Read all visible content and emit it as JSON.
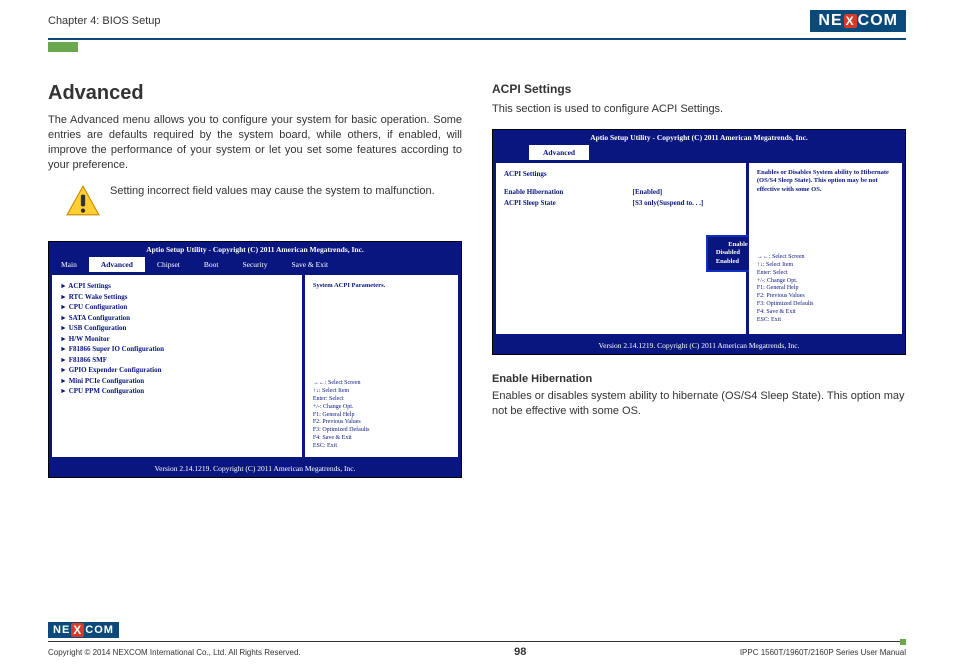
{
  "header": {
    "chapter": "Chapter 4: BIOS Setup",
    "logo_text_1": "NE",
    "logo_text_x": "X",
    "logo_text_2": "COM"
  },
  "left": {
    "title": "Advanced",
    "intro": "The Advanced menu allows you to configure your system for basic operation. Some entries are defaults required by the system board, while others, if enabled, will improve the performance of your system or let you set some features according to your preference.",
    "warning": "Setting incorrect field values may cause the system to malfunction.",
    "bios": {
      "title": "Aptio Setup Utility - Copyright (C) 2011 American Megatrends, Inc.",
      "tabs": [
        "Main",
        "Advanced",
        "Chipset",
        "Boot",
        "Security",
        "Save & Exit"
      ],
      "active_tab": 1,
      "items": [
        "ACPI Settings",
        "RTC Wake Settings",
        "CPU Configuration",
        "SATA Configuration",
        "USB Configuration",
        "H/W Monitor",
        "F81866 Super IO Configuration",
        "F81866 SMF",
        "GPIO Expender Configuration",
        "Mini PCIe Configuration",
        "CPU PPM Configuration"
      ],
      "right_top": "System ACPI Parameters.",
      "help": [
        "→←: Select Screen",
        "↑↓: Select Item",
        "Enter: Select",
        "+/-: Change Opt.",
        "F1: General Help",
        "F2: Previous Values",
        "F3: Optimized Defaults",
        "F4: Save & Exit",
        "ESC: Exit"
      ],
      "footer": "Version 2.14.1219. Copyright (C) 2011 American Megatrends, Inc."
    }
  },
  "right": {
    "title": "ACPI Settings",
    "intro": "This section is used to configure ACPI Settings.",
    "bios": {
      "title": "Aptio Setup Utility - Copyright (C) 2011 American Megatrends, Inc.",
      "tab_label": "Advanced",
      "section": "ACPI Settings",
      "row1_label": "Enable Hibernation",
      "row1_val": "[Enabled]",
      "row2_label": "ACPI Sleep State",
      "row2_val": "[S3 only(Suspend to. . .]",
      "right_top": "Enables or Disables System ability to Hibernate (OS/S4 Sleep State). This option may be not effective with some OS.",
      "popup_title": "Enable Hibernation",
      "popup_opt1": "Disabled",
      "popup_opt2": "Enabled",
      "help": [
        "→←: Select Screen",
        "↑↓: Select Item",
        "Enter: Select",
        "+/-: Change Opt.",
        "F1: General Help",
        "F2: Previous Values",
        "F3: Optimized Defaults",
        "F4: Save & Exit",
        "ESC: Exit"
      ],
      "footer": "Version 2.14.1219. Copyright (C) 2011 American Megatrends, Inc."
    },
    "sub_title": "Enable Hibernation",
    "sub_text": "Enables or disables system ability to hibernate (OS/S4 Sleep State). This option may not be effective with some OS."
  },
  "footer": {
    "copyright": "Copyright © 2014 NEXCOM International Co., Ltd. All Rights Reserved.",
    "page": "98",
    "manual": "IPPC 1560T/1960T/2160P Series User Manual"
  }
}
